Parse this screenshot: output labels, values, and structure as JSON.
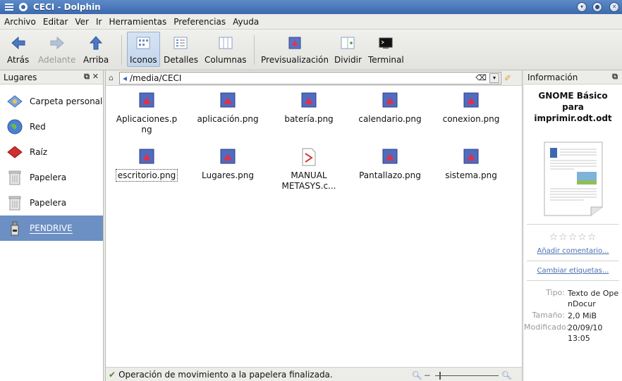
{
  "window": {
    "title": "CECI - Dolphin"
  },
  "menubar": [
    "Archivo",
    "Editar",
    "Ver",
    "Ir",
    "Herramientas",
    "Preferencias",
    "Ayuda"
  ],
  "toolbar": {
    "back": "Atrás",
    "forward": "Adelante",
    "up": "Arriba",
    "icons": "Iconos",
    "details": "Detalles",
    "columns": "Columnas",
    "preview": "Previsualización",
    "split": "Dividir",
    "terminal": "Terminal"
  },
  "places": {
    "title": "Lugares",
    "items": [
      {
        "label": "Carpeta personal",
        "icon": "home-icon"
      },
      {
        "label": "Red",
        "icon": "network-icon"
      },
      {
        "label": "Raíz",
        "icon": "root-icon"
      },
      {
        "label": "Papelera",
        "icon": "trash-icon"
      },
      {
        "label": "Papelera",
        "icon": "trash-icon"
      },
      {
        "label": "PENDRIVE",
        "icon": "usb-drive-icon",
        "selected": true
      }
    ]
  },
  "location": {
    "path": "/media/CECI"
  },
  "files": [
    {
      "name": "Aplicaciones.p\nng"
    },
    {
      "name": "aplicación.png"
    },
    {
      "name": "batería.png"
    },
    {
      "name": "calendario.png"
    },
    {
      "name": "conexion.png"
    },
    {
      "name": "escritorio.png"
    },
    {
      "name": "Lugares.png"
    },
    {
      "name": "MANUAL\nMETASYS.c..."
    },
    {
      "name": "Pantallazo.png"
    },
    {
      "name": "sistema.png"
    }
  ],
  "status": {
    "message": "Operación de movimiento a la papelera finalizada."
  },
  "info": {
    "title": "Información",
    "filename": "GNOME Básico para imprimir.odt.odt",
    "add_comment": "Añadir comentario...",
    "change_tags": "Cambiar etiquetas...",
    "labels": {
      "type": "Tipo:",
      "size": "Tamaño:",
      "modified": "Modificado:"
    },
    "type_value": "Texto de OpenDocur",
    "size_value": "2,0 MiB",
    "modified_value": "20/09/10\n13:05",
    "rating": 0
  },
  "colors": {
    "titlebar": "#4a78bb",
    "selection": "#6c8fc4",
    "link": "#4a6fb3"
  }
}
